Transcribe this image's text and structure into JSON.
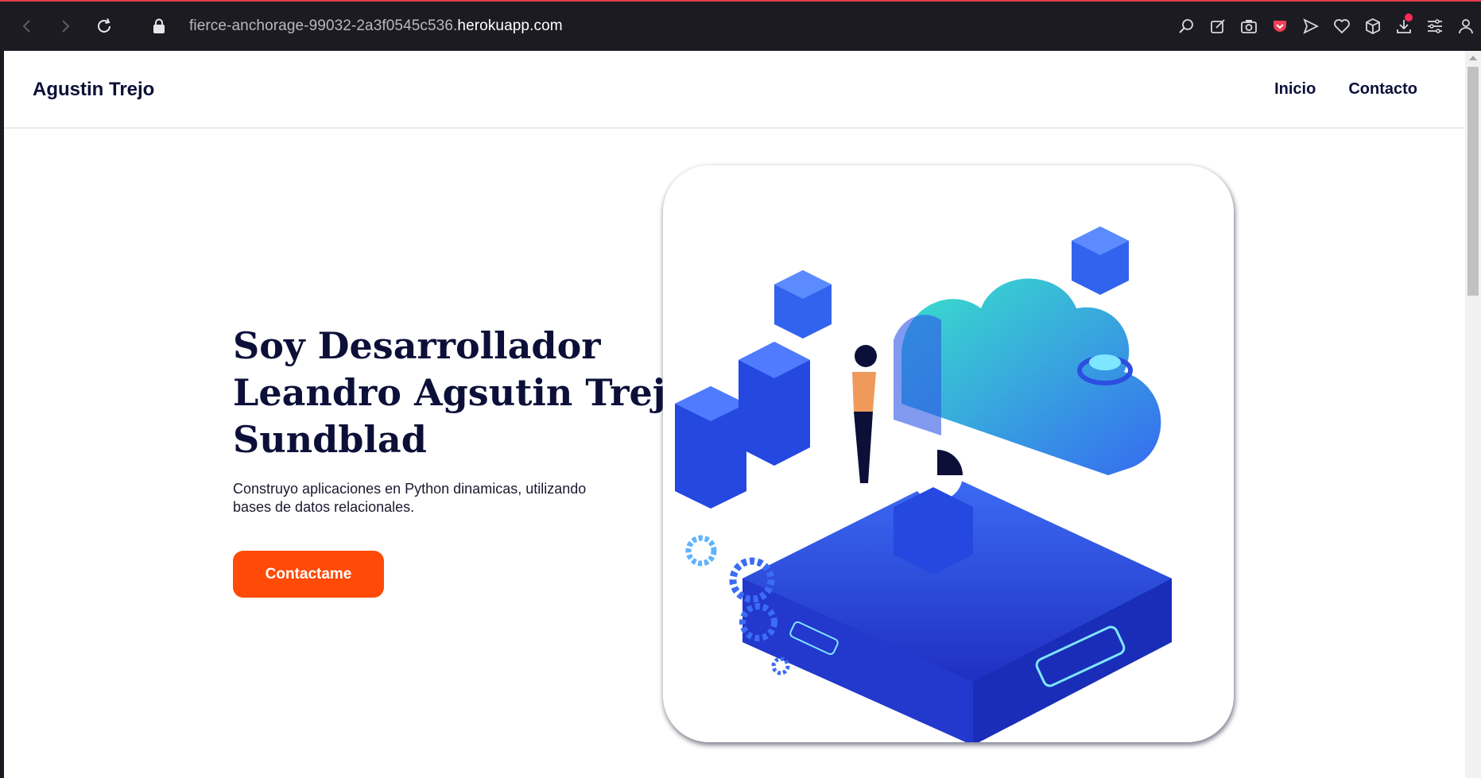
{
  "browser": {
    "url_prefix": "fierce-anchorage-99032-2a3f0545c536.",
    "url_host": "herokuapp.com",
    "accent": "#e23b4a"
  },
  "site": {
    "brand": "Agustin Trejo",
    "menu": [
      {
        "label": "Inicio"
      },
      {
        "label": "Contacto"
      }
    ]
  },
  "hero": {
    "title_lines": [
      "Soy Desarrollador",
      "Leandro Agsutin Trejo",
      "Sundblad"
    ],
    "subtitle_line1": "Construyo aplicaciones en Python dinamicas, utilizando",
    "subtitle_line2": "bases de datos relacionales.",
    "cta_label": "Contactame",
    "cta_color": "#ff4a08",
    "text_color": "#0c1038"
  },
  "illustration": {
    "icon": "isometric-cloud-server-illustration",
    "primary_color": "#2f55e6",
    "accent_color": "#2fe0c8"
  }
}
